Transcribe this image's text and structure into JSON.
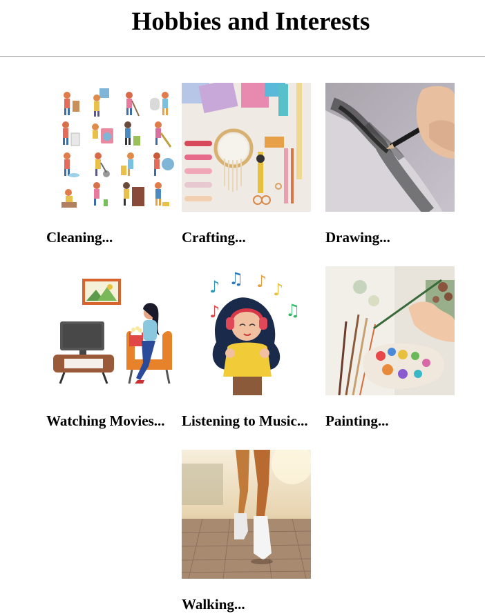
{
  "page": {
    "title": "Hobbies and Interests"
  },
  "hobbies": [
    {
      "label": "Cleaning...",
      "image": "cleaning-kids-illustration"
    },
    {
      "label": "Crafting...",
      "image": "crafting-supplies-photo"
    },
    {
      "label": "Drawing...",
      "image": "pencil-drawing-photo"
    },
    {
      "label": "Watching Movies...",
      "image": "watching-tv-illustration"
    },
    {
      "label": "Listening to Music...",
      "image": "headphones-girl-illustration"
    },
    {
      "label": "Painting...",
      "image": "paint-palette-photo"
    },
    {
      "label": "Walking...",
      "image": "walking-feet-photo"
    }
  ]
}
